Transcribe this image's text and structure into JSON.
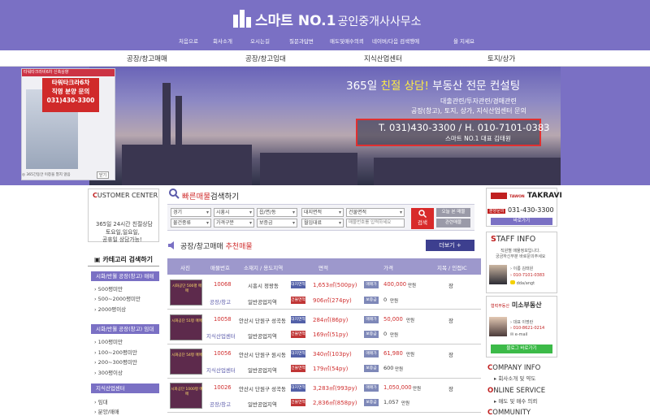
{
  "header": {
    "title": "스마트 NO.1",
    "title_sub": "공인중개사사무소",
    "topnav": [
      "처음으로",
      "회사소개",
      "오시는길",
      "질문과답변",
      "매도및매수의뢰",
      "네이버/다음 검색행에",
      "을 지세요"
    ]
  },
  "mainnav": [
    "공장/창고매매",
    "공장/창고임대",
    "지식산업센터",
    "토지/상가"
  ],
  "banner": {
    "slogan_pre": "365일",
    "slogan_hl": "친절 상담!",
    "slogan_post": "부동산 전문 컨설팅",
    "line1": "대출관련/투자관련/경매관련",
    "line2": "공장(창고), 토지, 상가, 지식산업센터 문의",
    "phone": "T. 031)430-3300 / H. 010-7101-0383",
    "phone_sub": "스마트 NO.1 대표 김태원"
  },
  "ad": {
    "top": "타워타크라비6차 신축상향",
    "tag1": "타워타크라6차",
    "tag2": "직영 분양 문의",
    "tag3": "031)430-3300",
    "footer": "◎ 365간동안 이창을 열지 않음",
    "close": "닫기"
  },
  "customer_center": {
    "title_first": "C",
    "title_rest": "USTOMER CENTER",
    "line1": "365일 24시간 친절상담",
    "line2": "토요일,일요일,",
    "line3": "공휴일 상담가능!"
  },
  "category": {
    "title": "카테고리 검색하기",
    "groups": [
      {
        "label": "시화/반월 공장(창고) 매매",
        "items": [
          "500평미만",
          "500~2000평미만",
          "2000평이상"
        ]
      },
      {
        "label": "시화/반월 공장(창고) 임대",
        "items": [
          "100평미만",
          "100~200평미만",
          "200~300평미만",
          "300평이상"
        ]
      },
      {
        "label": "지식산업센터",
        "items": [
          "임대",
          "분양/매매"
        ]
      }
    ]
  },
  "quick_search": {
    "title_hl": "빠른매물",
    "title_rest": "검색하기",
    "row1": [
      "경기",
      "시흥시",
      "읍/면/동",
      "대지면적",
      "건물면적"
    ],
    "row2": [
      "물건종류",
      "가격구분",
      "보증금",
      "월임대료"
    ],
    "placeholder": "매물번호를 입력하세요",
    "search_btn": "검색",
    "today_btn": "오늘 본 매물",
    "related_btn": "관련매물"
  },
  "listing": {
    "title_pre": "공장/창고매매",
    "title_hl": "추천매물",
    "more_btn": "더보기 +",
    "headers": [
      "사진",
      "매물번호",
      "소재지 / 용도지역",
      "면적",
      "가격",
      "지목 / 인접IC"
    ],
    "rows": [
      {
        "thumb": "시화공단 500평 매매",
        "no": "10068",
        "type": "공장/창고",
        "loc": "시흥시 정왕동",
        "zone": "일반공업지역",
        "land": "1,653㎡(500py)",
        "bldg": "906㎡(274py)",
        "price_label": "매매가",
        "price": "400,000",
        "unit": "만원",
        "dep_label": "보증금",
        "dep": "0",
        "jimok": "장"
      },
      {
        "thumb": "시화공단 51평 매매",
        "no": "10058",
        "type": "지식산업센터",
        "loc": "안산시 단원구 성곡동",
        "zone": "일반공업지역",
        "land": "284㎡(86py)",
        "bldg": "169㎡(51py)",
        "price_label": "매매가",
        "price": "50,000",
        "unit": "만원",
        "dep_label": "보증금",
        "dep": "0",
        "jimok": "장"
      },
      {
        "thumb": "시화공단 54평 매매",
        "no": "10056",
        "type": "지식산업센터",
        "loc": "안산시 단원구 원시동",
        "zone": "일반공업지역",
        "land": "340㎡(103py)",
        "bldg": "179㎡(54py)",
        "price_label": "매매가",
        "price": "61,980",
        "unit": "만원",
        "dep_label": "보증금",
        "dep": "600",
        "jimok": "장"
      },
      {
        "thumb": "시화공단 1000평 매매",
        "no": "10026",
        "type": "공장/창고",
        "loc": "안산시 단원구 성곡동",
        "zone": "일반공업지역",
        "land": "3,283㎡(993py)",
        "bldg": "2,836㎡(858py)",
        "price_label": "매매가",
        "price": "1,050,000",
        "unit": "만원",
        "dep_label": "보증금",
        "dep": "1,057",
        "jimok": "장"
      }
    ],
    "tag_land": "대지면적",
    "tag_bldg": "건물면적"
  },
  "right": {
    "brand": "TAKRAVI",
    "brand_small": "TAWON",
    "tel_badge": "분양문의",
    "tel": "031-430-3300",
    "brand_btn": "바로가기",
    "staff_first": "S",
    "staff_rest": "TAFF INFO",
    "staff_note1": "직원별 매물정보입니다.",
    "staff_note2": "궁금하신부분 바로문의주세요",
    "staff_name": "› 이름 김태원",
    "staff_tel": "› 010-7101-0383",
    "staff_kakao": "dda/angt",
    "agent_small": "협력부동산",
    "agent_title": "미소부동산",
    "agent_name": "› 대표 이명란",
    "agent_tel": "› 010-8621-0214",
    "agent_mail": "e-mail",
    "blog_btn": "블로그 바로가기",
    "company_first": "C",
    "company_rest": "OMPANY INFO",
    "company_sub": "▸ 회사소개 및 약도",
    "online_first": "O",
    "online_rest": "NLINE SERVICE",
    "online_sub": "▸ 매도 및 매수 의뢰",
    "community_first": "C",
    "community_rest": "OMMUNITY"
  }
}
